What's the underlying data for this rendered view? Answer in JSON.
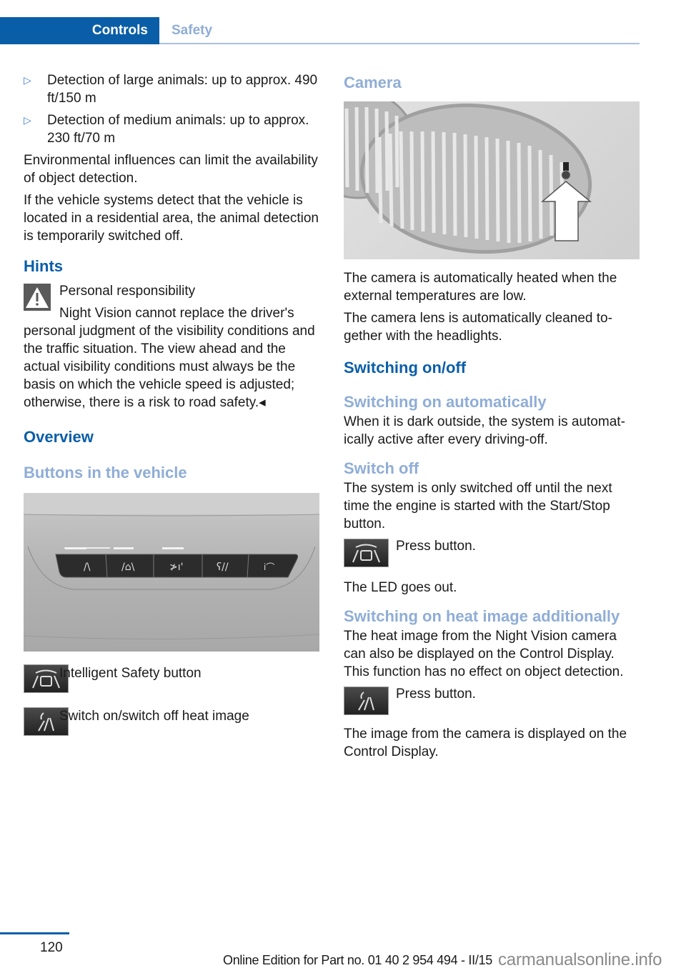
{
  "header": {
    "active_tab": "Controls",
    "next_tab": "Safety"
  },
  "left": {
    "bullets": [
      "Detection of large animals: up to approx. 490 ft/150 m",
      "Detection of medium animals: up to ap­prox. 230 ft/70 m"
    ],
    "para1": "Environmental influences can limit the availa­bility of object detection.",
    "para2": "If the vehicle systems detect that the vehicle is located in a residential area, the animal detec­tion is temporarily switched off.",
    "hints_heading": "Hints",
    "warning": {
      "icon": "warning-triangle-icon",
      "title": "Personal responsibility",
      "body": "Night Vision cannot replace the driver's personal judgment of the visibility conditions and the traffic situation. The view ahead and the actual visibility conditions must always be the basis on which the vehicle speed is ad­justed; otherwise, there is a risk to road safety.◂"
    },
    "overview_heading": "Overview",
    "buttons_heading": "Buttons in the vehicle",
    "figure_alt": "Button panel in the vehicle",
    "legend": [
      {
        "icon": "intelligent-safety-icon",
        "label": "Intelligent Safety button"
      },
      {
        "icon": "heat-image-icon",
        "label": "Switch on/switch off heat image"
      }
    ]
  },
  "right": {
    "camera_heading": "Camera",
    "camera_figure_alt": "Night Vision camera in kidney grille",
    "para1": "The camera is automatically heated when the external temperatures are low.",
    "para2": "The camera lens is automatically cleaned to­gether with the headlights.",
    "switching_heading": "Switching on/off",
    "auto_heading": "Switching on automatically",
    "auto_text": "When it is dark outside, the system is automat­ically active after every driving-off.",
    "off_heading": "Switch off",
    "off_text": "The system is only switched off until the next time the engine is started with the Start/Stop button.",
    "press1": "Press button.",
    "led_text": "The LED goes out.",
    "heat_heading": "Switching on heat image additionally",
    "heat_text": "The heat image from the Night Vision camera can also be displayed on the Control Display. This function has no effect on object detec­tion.",
    "press2": "Press button.",
    "final_text": "The image from the camera is displayed on the Control Display."
  },
  "footer": {
    "page_number": "120",
    "edition": "Online Edition for Part no. 01 40 2 954 494 - II/15",
    "watermark": "carmanualsonline.info"
  },
  "colors": {
    "primary_blue": "#0a5ea8",
    "light_blue": "#8fadd6"
  }
}
